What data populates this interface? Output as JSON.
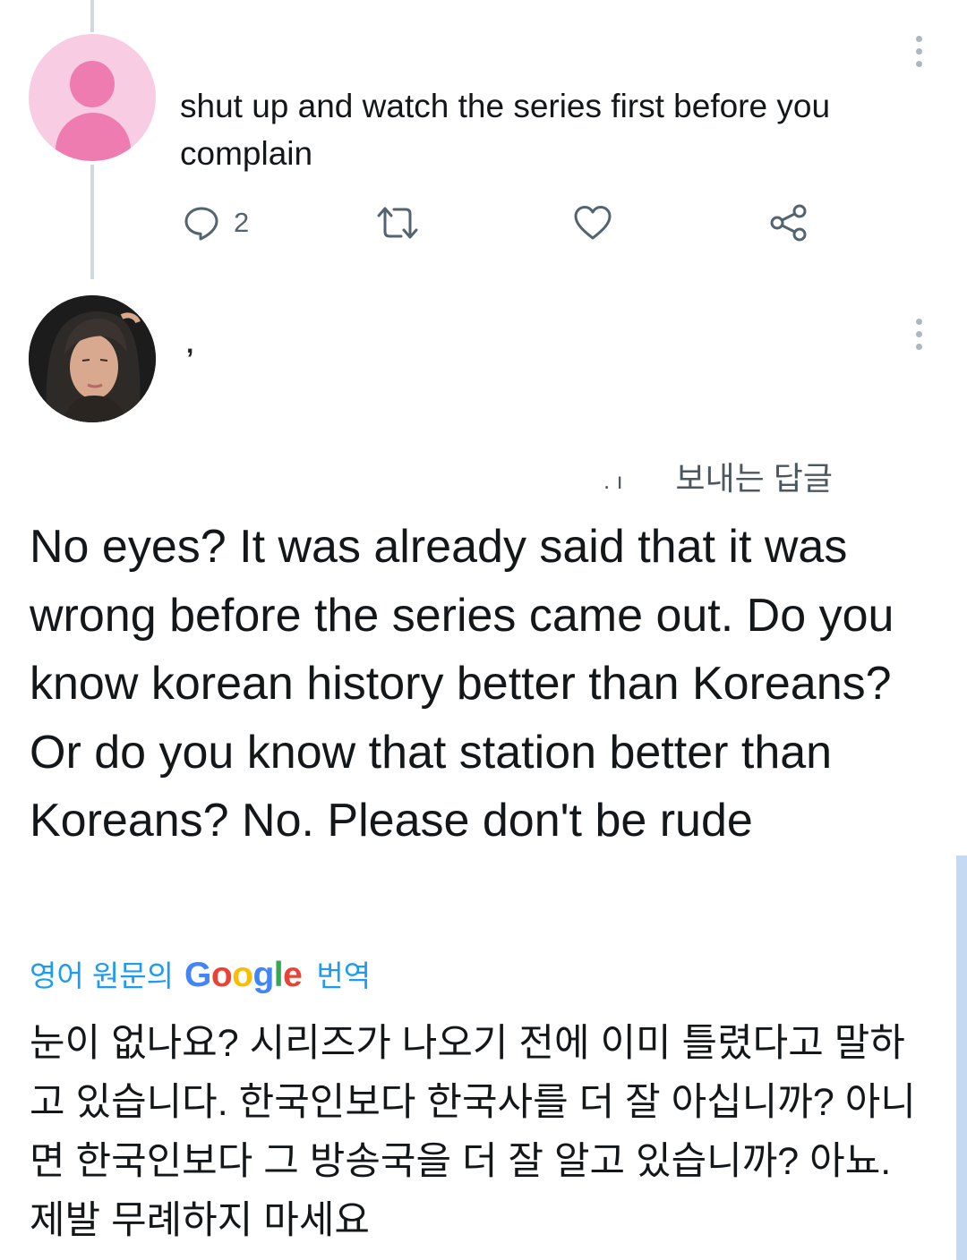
{
  "reply_1": {
    "text": "shut up and watch the series first before you complain",
    "actions": {
      "reply_count": "2"
    }
  },
  "reply_2": {
    "handle_fragment": ",",
    "reply_label": "보내는 답글",
    "reply_label_marks": ". ı",
    "text": "No eyes?  It was already said that it was wrong before the series came out.  Do you know korean history better than Koreans?  Or do you know that station better than Koreans?  No.  Please don't be rude",
    "translation": {
      "source_prefix": "영어 원문의",
      "google_logo": "Google",
      "label": "번역",
      "text": "눈이 없나요? 시리즈가 나오기 전에 이미 틀렸다고 말하고 있습니다. 한국인보다 한국사를 더 잘 아십니까? 아니면 한국인보다 그 방송국을 더 잘 알고 있습니까? 아뇨. 제발 무례하지 마세요"
    }
  },
  "icons": {
    "reply": "comment-icon",
    "retweet": "retweet-icon",
    "like": "heart-icon",
    "share": "share-icon",
    "more": "kebab-menu-icon"
  },
  "colors": {
    "link": "#1d9bf0",
    "icon": "#536471",
    "avatar_bg": "#f8cde3",
    "avatar_fg": "#ef7cb1"
  }
}
